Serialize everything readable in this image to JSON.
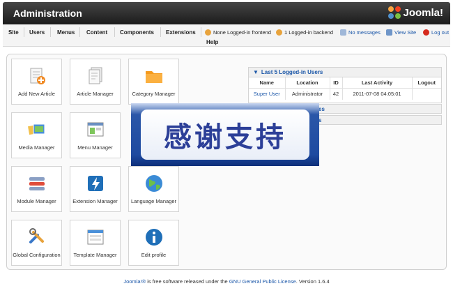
{
  "header": {
    "title": "Administration",
    "logo_text": "Joomla!"
  },
  "menu": {
    "site": "Site",
    "users": "Users",
    "menus": "Menus",
    "content": "Content",
    "components": "Components",
    "extensions": "Extensions",
    "help": "Help"
  },
  "status": {
    "frontend": "None Logged-in frontend",
    "backend": "1 Logged-in backend",
    "messages": "No messages",
    "view_site": "View Site",
    "logout": "Log out"
  },
  "quickicons": [
    {
      "label": "Add New Article",
      "icon": "add-article-icon"
    },
    {
      "label": "Article Manager",
      "icon": "article-manager-icon"
    },
    {
      "label": "Category Manager",
      "icon": "folder-icon"
    },
    {
      "label": "Media Manager",
      "icon": "media-icon"
    },
    {
      "label": "Menu Manager",
      "icon": "menu-icon"
    },
    {
      "label": "Module Manager",
      "icon": "module-icon"
    },
    {
      "label": "Extension Manager",
      "icon": "extension-icon"
    },
    {
      "label": "Language Manager",
      "icon": "globe-icon"
    },
    {
      "label": "Global Configuration",
      "icon": "tools-icon"
    },
    {
      "label": "Template Manager",
      "icon": "template-icon"
    },
    {
      "label": "Edit profile",
      "icon": "info-icon"
    }
  ],
  "logged_in": {
    "title": "Last 5 Logged-in Users",
    "columns": [
      "Name",
      "Location",
      "ID",
      "Last Activity",
      "Logout"
    ],
    "rows": [
      {
        "name": "Super User",
        "location": "Administrator",
        "id": "42",
        "last_activity": "2011-07-08 04:05:01",
        "logout": ""
      }
    ]
  },
  "partial_panels": [
    "es",
    "s"
  ],
  "overlay": {
    "text": "感谢支持"
  },
  "footer": {
    "brand": "Joomla!®",
    "mid": " is free software released under the ",
    "license": "GNU General Public License",
    "version": ".    Version 1.6.4"
  },
  "colors": {
    "link": "#1a56a8",
    "header_dark": "#1b1b1b",
    "overlay_blue": "#2b57a8"
  }
}
